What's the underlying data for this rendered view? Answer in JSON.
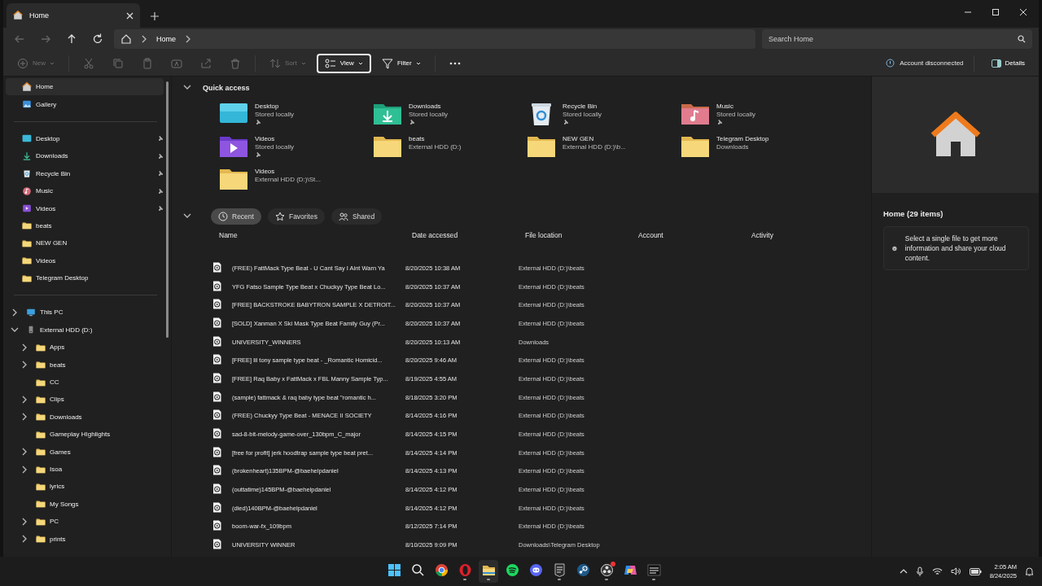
{
  "tab": {
    "title": "Home"
  },
  "address": {
    "crumbs": [
      "Home"
    ],
    "search_placeholder": "Search Home"
  },
  "toolbar": [
    {
      "kind": "new",
      "label": "New",
      "disabled": true
    },
    {
      "kind": "cut",
      "disabled": true
    },
    {
      "kind": "copy",
      "disabled": true
    },
    {
      "kind": "paste",
      "disabled": true
    },
    {
      "kind": "rename",
      "disabled": true
    },
    {
      "kind": "share",
      "disabled": true
    },
    {
      "kind": "delete",
      "disabled": true
    },
    {
      "kind": "sort",
      "label": "Sort",
      "disabled": true
    },
    {
      "kind": "view",
      "label": "View",
      "disabled": false,
      "selected": true
    },
    {
      "kind": "filter",
      "label": "Filter",
      "disabled": false,
      "selected": false
    },
    {
      "kind": "more",
      "disabled": false
    }
  ],
  "account_status": "Account disconnected",
  "details_button": "Details",
  "sidebar": {
    "groups": [
      [
        {
          "kind": "home",
          "label": "Home",
          "selected": true
        },
        {
          "kind": "gallery",
          "label": "Gallery",
          "selected": false
        }
      ],
      [
        {
          "kind": "desktop",
          "label": "Desktop",
          "pinned": true,
          "selected": false
        },
        {
          "kind": "downloads",
          "label": "Downloads",
          "pinned": true,
          "selected": false
        },
        {
          "kind": "recycle",
          "label": "Recycle Bin",
          "pinned": true,
          "selected": false
        },
        {
          "kind": "music",
          "label": "Music",
          "pinned": true,
          "selected": false
        },
        {
          "kind": "videos",
          "label": "Videos",
          "pinned": true,
          "selected": false
        },
        {
          "kind": "folder",
          "label": "beats",
          "pinned": false,
          "selected": false
        },
        {
          "kind": "folder",
          "label": "NEW GEN",
          "pinned": false,
          "selected": false
        },
        {
          "kind": "folder",
          "label": "Videos",
          "pinned": false,
          "selected": false
        },
        {
          "kind": "folder",
          "label": "Telegram Desktop",
          "pinned": false,
          "selected": false
        }
      ],
      [
        {
          "kind": "pc",
          "label": "This PC",
          "expandable": true,
          "expanded": false,
          "selected": false
        },
        {
          "kind": "drive",
          "label": "External HDD (D:)",
          "expandable": true,
          "expanded": true,
          "selected": false,
          "children": [
            {
              "kind": "folder",
              "label": "Apps",
              "expandable": true,
              "expanded": false,
              "selected": false
            },
            {
              "kind": "folder",
              "label": "beats",
              "expandable": true,
              "expanded": false,
              "selected": false
            },
            {
              "kind": "folder",
              "label": "CC",
              "expandable": false,
              "selected": false
            },
            {
              "kind": "folder",
              "label": "Clips",
              "expandable": true,
              "expanded": false,
              "selected": false
            },
            {
              "kind": "folder",
              "label": "Downloads",
              "expandable": true,
              "expanded": false,
              "selected": false
            },
            {
              "kind": "folder",
              "label": "Gameplay HIghlights",
              "expandable": false,
              "selected": false
            },
            {
              "kind": "folder",
              "label": "Games",
              "expandable": true,
              "expanded": false,
              "selected": false
            },
            {
              "kind": "folder",
              "label": "Isoa",
              "expandable": true,
              "expanded": false,
              "selected": false
            },
            {
              "kind": "folder",
              "label": "lyrics",
              "expandable": false,
              "selected": false
            },
            {
              "kind": "folder",
              "label": "My Songs",
              "expandable": false,
              "selected": false
            },
            {
              "kind": "folder",
              "label": "PC",
              "expandable": true,
              "expanded": false,
              "selected": false
            },
            {
              "kind": "folder",
              "label": "prints",
              "expandable": true,
              "expanded": false,
              "selected": false
            }
          ]
        }
      ]
    ]
  },
  "quick_access": {
    "title": "Quick access",
    "expanded": true,
    "items": [
      {
        "kind": "desktop",
        "name": "Desktop",
        "location": "Stored locally",
        "pinned": true
      },
      {
        "kind": "downloads",
        "name": "Downloads",
        "location": "Stored locally",
        "pinned": true
      },
      {
        "kind": "recycle",
        "name": "Recycle Bin",
        "location": "Stored locally",
        "pinned": true
      },
      {
        "kind": "music",
        "name": "Music",
        "location": "Stored locally",
        "pinned": true
      },
      {
        "kind": "videos",
        "name": "Videos",
        "location": "Stored locally",
        "pinned": true
      },
      {
        "kind": "folder",
        "name": "beats",
        "location": "External HDD (D:)"
      },
      {
        "kind": "folder",
        "name": "NEW GEN",
        "location": "External HDD (D:)\\b..."
      },
      {
        "kind": "folder",
        "name": "Telegram Desktop",
        "location": "Downloads"
      },
      {
        "kind": "folder",
        "name": "Videos",
        "location": "External HDD (D:)\\St..."
      }
    ]
  },
  "recent": {
    "expanded": true,
    "filters": [
      {
        "kind": "recent",
        "label": "Recent",
        "selected": true
      },
      {
        "kind": "favorites",
        "label": "Favorites",
        "selected": false
      },
      {
        "kind": "shared",
        "label": "Shared",
        "selected": false
      }
    ],
    "columns": [
      "Name",
      "Date accessed",
      "File location",
      "Account",
      "Activity"
    ],
    "rows": [
      [
        "(FREE) FattMack Type Beat - U Cant Say I Aint Warn Ya",
        "8/20/2025 10:38 AM",
        "External HDD (D:)\\beats"
      ],
      [
        "YFG Fatso Sample Type Beat x Chuckyy Type Beat Lo...",
        "8/20/2025 10:37 AM",
        "External HDD (D:)\\beats"
      ],
      [
        "[FREE] BACKSTROKE BABYTRON SAMPLE X DETROIT...",
        "8/20/2025 10:37 AM",
        "External HDD (D:)\\beats"
      ],
      [
        "[SOLD] Xanman X Ski Mask Type Beat Family Guy (Pr...",
        "8/20/2025 10:37 AM",
        "External HDD (D:)\\beats"
      ],
      [
        "UNIVERSITY_WINNERS",
        "8/20/2025 10:13 AM",
        "Downloads"
      ],
      [
        "[FREE] lil tony sample type beat - _Romantic Homicid...",
        "8/20/2025 9:46 AM",
        "External HDD (D:)\\beats"
      ],
      [
        "[FREE] Raq Baby x FattMack x FBL Manny Sample Typ...",
        "8/19/2025 4:55 AM",
        "External HDD (D:)\\beats"
      ],
      [
        "(sample) fattmack & raq baby type beat \"romantic h...",
        "8/18/2025 3:20 PM",
        "External HDD (D:)\\beats"
      ],
      [
        "(FREE) Chuckyy Type Beat  - MENACE II SOCIETY",
        "8/14/2025 4:16 PM",
        "External HDD (D:)\\beats"
      ],
      [
        "sad-8-bit-melody-game-over_130bpm_C_major",
        "8/14/2025 4:15 PM",
        "External HDD (D:)\\beats"
      ],
      [
        "[free for profit] jerk  hoodtrap  sample type beat pret...",
        "8/14/2025 4:14 PM",
        "External HDD (D:)\\beats"
      ],
      [
        "(brokenheart)135BPM-@baehelpdaniel",
        "8/14/2025 4:13 PM",
        "External HDD (D:)\\beats"
      ],
      [
        "(outtatime)145BPM-@baehelpdaniel",
        "8/14/2025 4:12 PM",
        "External HDD (D:)\\beats"
      ],
      [
        "(died)140BPM-@baehelpdaniel",
        "8/14/2025 4:12 PM",
        "External HDD (D:)\\beats"
      ],
      [
        "boom-war-fx_109bpm",
        "8/12/2025 7:14 PM",
        "External HDD (D:)\\beats"
      ],
      [
        "UNIVERSITY WINNER",
        "8/10/2025 9:09 PM",
        "Downloads\\Telegram Desktop"
      ]
    ]
  },
  "details": {
    "title": "Home (29 items)",
    "message": "Select a single file to get more information and share your cloud content."
  },
  "taskbar": {
    "apps": [
      {
        "kind": "start",
        "running": false
      },
      {
        "kind": "search",
        "running": false
      },
      {
        "kind": "chrome",
        "running": false
      },
      {
        "kind": "opera",
        "running": true
      },
      {
        "kind": "explorer",
        "running": true,
        "selected": true
      },
      {
        "kind": "spotify",
        "running": false
      },
      {
        "kind": "discord",
        "running": false
      },
      {
        "kind": "epic",
        "running": true
      },
      {
        "kind": "steam",
        "running": false
      },
      {
        "kind": "obs",
        "running": true,
        "badge": true
      },
      {
        "kind": "copilot",
        "running": false
      },
      {
        "kind": "cod",
        "running": true
      }
    ],
    "time": "2:05 AM",
    "date": "8/24/2025"
  }
}
